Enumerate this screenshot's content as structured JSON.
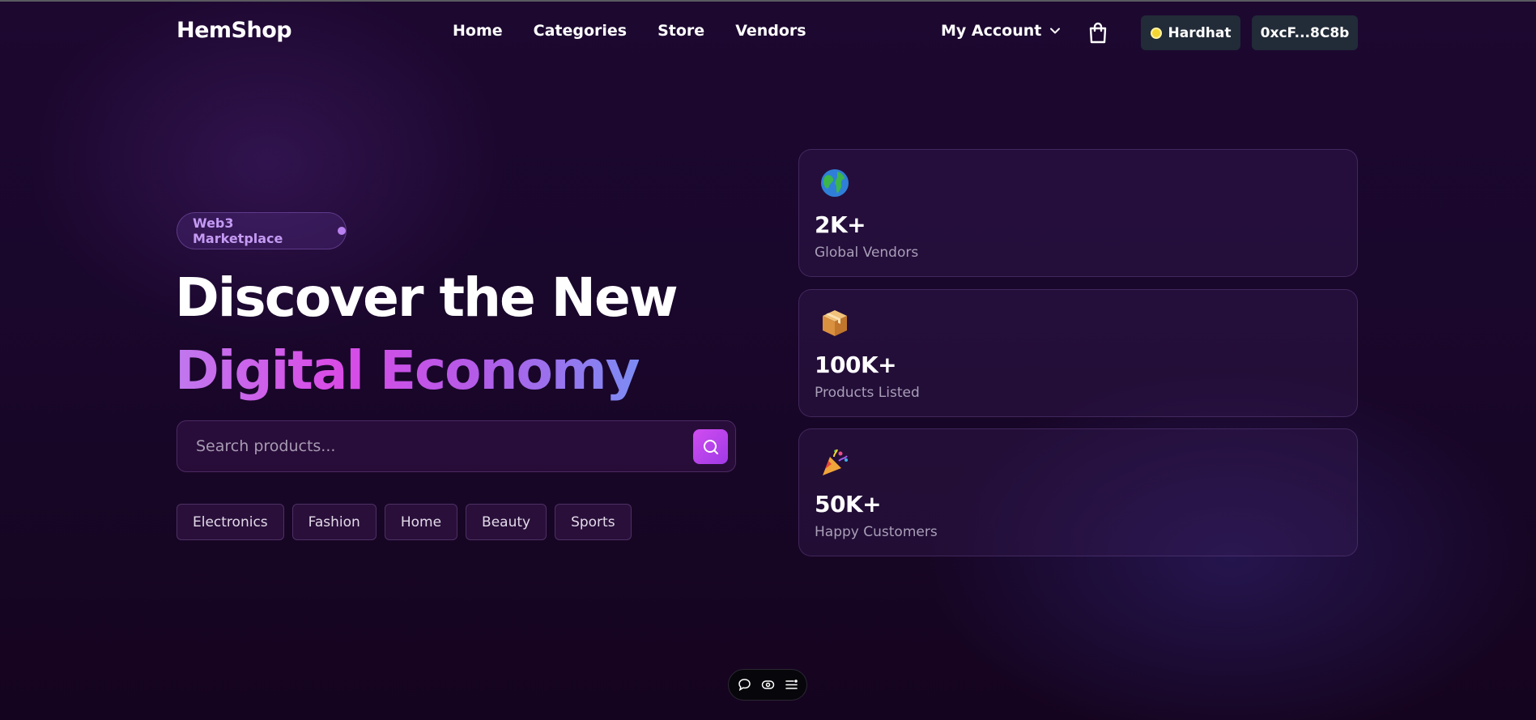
{
  "nav": {
    "logo": "HemShop",
    "links": [
      "Home",
      "Categories",
      "Store",
      "Vendors"
    ],
    "account_label": "My Account",
    "network_label": "Hardhat",
    "wallet_address": "0xcF...8C8b"
  },
  "hero": {
    "badge": "Web3 Marketplace",
    "title_line1": "Discover the New",
    "title_line2": "Digital Economy",
    "search_placeholder": "Search products...",
    "categories": [
      "Electronics",
      "Fashion",
      "Home",
      "Beauty",
      "Sports"
    ]
  },
  "stats": [
    {
      "icon": "globe-icon",
      "value": "2K+",
      "label": "Global Vendors"
    },
    {
      "icon": "package-icon",
      "value": "100K+",
      "label": "Products Listed"
    },
    {
      "icon": "party-popper-icon",
      "value": "50K+",
      "label": "Happy Customers"
    }
  ],
  "colors": {
    "accent": "#c850ec",
    "gradient_start": "#c078ee",
    "gradient_end": "#7c8cf4",
    "background": "#1a072c",
    "button_dark": "#222b38"
  }
}
